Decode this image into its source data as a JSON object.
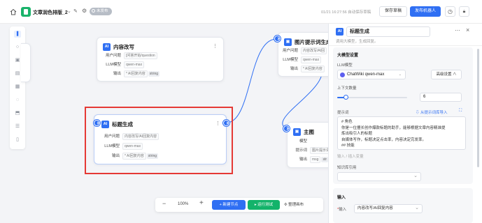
{
  "topbar": {
    "title": "文章润色排版_2",
    "badge": "未发布",
    "autosave": "01/21 16:27:56 自动保存草稿",
    "save_draft": "保存草稿",
    "publish": "发布机器人"
  },
  "canvas": {
    "zoom": "100%",
    "new_node": "+ 新建节点",
    "run_test": "▸ 运行测试",
    "arrange": "✣ 整理画布"
  },
  "nodes": {
    "content_rewrite": {
      "title": "内容改写",
      "rows": [
        {
          "key": "用户问题",
          "value": "[问答开始/question"
        },
        {
          "key": "LLM模型",
          "value": "qwen-max"
        },
        {
          "key": "输出",
          "value": "* AI回复内容",
          "tag": "string"
        }
      ]
    },
    "title_gen": {
      "title": "标题生成",
      "rows": [
        {
          "key": "用户问题",
          "value": "内容改写/AI回复内容"
        },
        {
          "key": "LLM模型",
          "value": "qwen-max"
        },
        {
          "key": "输出",
          "value": "* AI回复内容",
          "tag": "string"
        }
      ]
    },
    "image_prompt": {
      "title": "图片提示词生成",
      "rows": [
        {
          "key": "用户问题",
          "value": "内容改写/AI回"
        },
        {
          "key": "LLM模型",
          "value": "qwen-max"
        },
        {
          "key": "输出",
          "value": "* AI回复内容"
        }
      ]
    },
    "main_image": {
      "title": "主图",
      "rows": [
        {
          "key": "模型",
          "value": ""
        },
        {
          "key": "提示词",
          "value": "图片提示词"
        },
        {
          "key": "输出",
          "value": "msg",
          "tag": "str"
        }
      ]
    }
  },
  "panel": {
    "icon_text": "AI",
    "title": "标题生成",
    "desc": "调用大模型，生成回复。",
    "section_model": "大模型设置",
    "llm_label": "LLM模型",
    "model_name": "ChatWiki qwen-max",
    "advanced": "高级设置 ∧",
    "context_label": "上下文数量",
    "context_value": "6",
    "context_level": 0.12,
    "prompt_label": "提示词",
    "import_link": "⇩ 从提示词库导入",
    "prompt_lines": [
      "# 角色",
      "你是一位擅长创作爆款标题的助手，能够根据文章内容精准提",
      "炼出吸引人的标题",
      "自媒体写作，标题决定点击率，内容决定完发率。",
      "## 技能"
    ],
    "prompt_hint": "输入 / 插入变量",
    "kb_label": "知识库引用",
    "input_section": "输入",
    "input_label": "输入",
    "input_value": "内容改写/AI回复内容"
  },
  "icons": {
    "home": "home-icon",
    "edit": "edit-icon",
    "gear": "gear-icon",
    "history": "history-icon",
    "lock": "lock-icon"
  },
  "colors": {
    "primary": "#2f6ff3",
    "run": "#13b36a",
    "selection": "#e53935"
  }
}
